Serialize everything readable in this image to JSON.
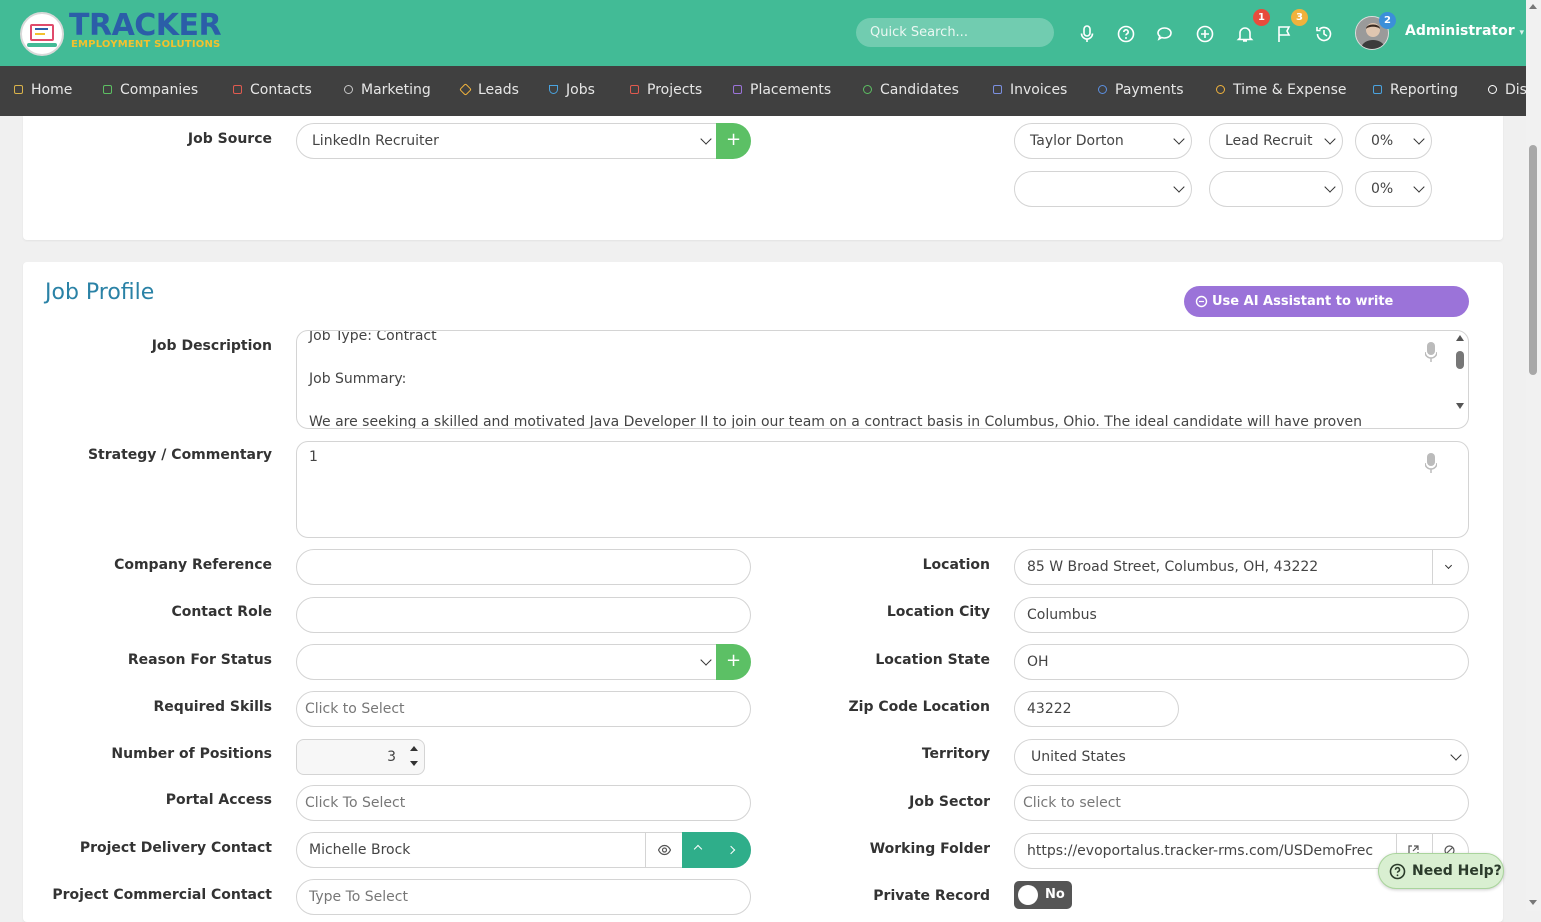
{
  "brand": {
    "name": "TRACKER",
    "tagline": "EMPLOYMENT SOLUTIONS"
  },
  "topbar": {
    "search_placeholder": "Quick Search...",
    "notifications_badge": "1",
    "flags_badge": "3",
    "avatar_badge": "2",
    "user_name": "Administrator"
  },
  "nav": {
    "items": [
      {
        "label": "Home",
        "icon": "home-icon",
        "color": "#d9b24a"
      },
      {
        "label": "Companies",
        "icon": "companies-icon",
        "color": "#5cbf62"
      },
      {
        "label": "Contacts",
        "icon": "contacts-icon",
        "color": "#e05a4f"
      },
      {
        "label": "Marketing",
        "icon": "marketing-icon",
        "color": "#c8c8c8"
      },
      {
        "label": "Leads",
        "icon": "leads-icon",
        "color": "#f0b23c"
      },
      {
        "label": "Jobs",
        "icon": "jobs-icon",
        "color": "#4aa3df"
      },
      {
        "label": "Projects",
        "icon": "projects-icon",
        "color": "#e05a4f"
      },
      {
        "label": "Placements",
        "icon": "placements-icon",
        "color": "#9b73d9"
      },
      {
        "label": "Candidates",
        "icon": "candidates-icon",
        "color": "#5cbf62"
      },
      {
        "label": "Invoices",
        "icon": "invoices-icon",
        "color": "#7b8fe0"
      },
      {
        "label": "Payments",
        "icon": "payments-icon",
        "color": "#5b8fe0"
      },
      {
        "label": "Time & Expense",
        "icon": "time-expense-icon",
        "color": "#f0b23c"
      },
      {
        "label": "Reporting",
        "icon": "reporting-icon",
        "color": "#4aa3df"
      },
      {
        "label": "Dis",
        "icon": "search-icon",
        "color": "#ffffff"
      }
    ]
  },
  "top_card": {
    "job_source_label": "Job Source",
    "job_source_value": "LinkedIn Recruiter",
    "recruiter_row1": {
      "name": "Taylor Dorton",
      "role": "Lead Recruit",
      "pct": "0%"
    },
    "recruiter_row2": {
      "name": "",
      "role": "",
      "pct": "0%"
    }
  },
  "job_profile": {
    "title": "Job Profile",
    "ai_button": "Use AI Assistant to write Specification",
    "job_description_label": "Job Description",
    "job_description_lines": [
      "Job Type: Contract",
      "Job Summary:",
      "We are seeking a skilled and motivated Java Developer II to join our team on a contract basis in Columbus, Ohio. The ideal candidate will have proven"
    ],
    "strategy_label": "Strategy / Commentary",
    "strategy_value": "1",
    "left_fields": {
      "company_reference": {
        "label": "Company Reference",
        "value": ""
      },
      "contact_role": {
        "label": "Contact Role",
        "value": ""
      },
      "reason_for_status": {
        "label": "Reason For Status",
        "value": ""
      },
      "required_skills": {
        "label": "Required Skills",
        "placeholder": "Click to Select"
      },
      "number_of_positions": {
        "label": "Number of Positions",
        "value": "3"
      },
      "portal_access": {
        "label": "Portal Access",
        "placeholder": "Click To Select"
      },
      "project_delivery_contact": {
        "label": "Project Delivery Contact",
        "value": "Michelle Brock"
      },
      "project_commercial_contact": {
        "label": "Project Commercial Contact",
        "placeholder": "Type To Select"
      }
    },
    "right_fields": {
      "location": {
        "label": "Location",
        "value": "85 W Broad Street, Columbus, OH, 43222"
      },
      "location_city": {
        "label": "Location City",
        "value": "Columbus"
      },
      "location_state": {
        "label": "Location State",
        "value": "OH"
      },
      "zip_code": {
        "label": "Zip Code Location",
        "value": "43222"
      },
      "territory": {
        "label": "Territory",
        "value": "United States"
      },
      "job_sector": {
        "label": "Job Sector",
        "placeholder": "Click to select"
      },
      "working_folder": {
        "label": "Working Folder",
        "value": "https://evoportalus.tracker-rms.com/USDemoFrec"
      },
      "private_record": {
        "label": "Private Record",
        "value": "No"
      }
    }
  },
  "help": {
    "label": "Need Help?"
  }
}
